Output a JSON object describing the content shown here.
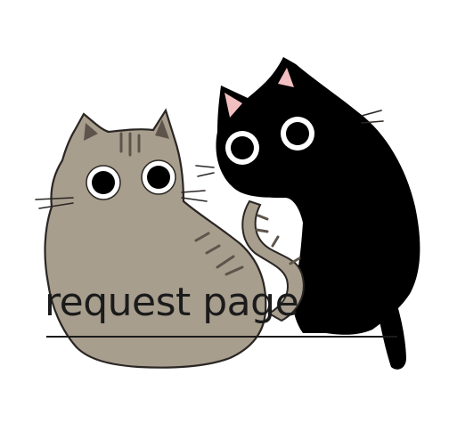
{
  "caption": {
    "text": "request page"
  },
  "illustration": {
    "subjects": [
      "gray-tabby-cat",
      "black-cat"
    ],
    "colors": {
      "background": "#ffffff",
      "gray_cat_fur": "#a89e8e",
      "gray_cat_stripes": "#5e544b",
      "black_cat_fur": "#000000",
      "ear_inner": "#f2bfc1",
      "outline": "#2a2623",
      "eye_white": "#ffffff",
      "pupil": "#000000"
    }
  }
}
